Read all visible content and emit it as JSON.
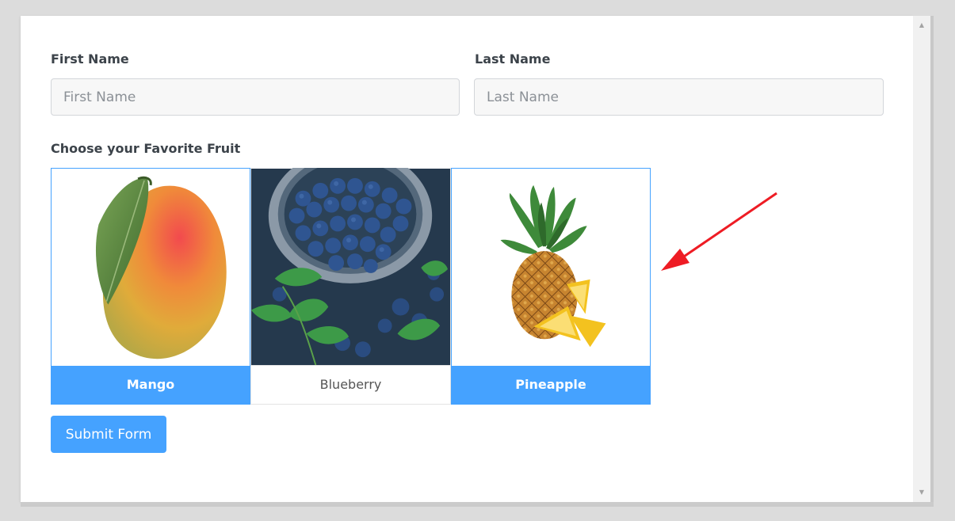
{
  "form": {
    "first_name": {
      "label": "First Name",
      "placeholder": "First Name",
      "value": ""
    },
    "last_name": {
      "label": "Last Name",
      "placeholder": "Last Name",
      "value": ""
    },
    "fruit_question": "Choose your Favorite Fruit",
    "fruits": [
      {
        "label": "Mango",
        "selected": true
      },
      {
        "label": "Blueberry",
        "selected": false
      },
      {
        "label": "Pineapple",
        "selected": true
      }
    ],
    "submit_label": "Submit Form"
  },
  "colors": {
    "accent": "#45a2ff",
    "annotation_arrow": "#ee1c24",
    "label_text": "#3c434a"
  },
  "icons": {
    "scroll_up": "triangle-up",
    "scroll_down": "triangle-down"
  }
}
